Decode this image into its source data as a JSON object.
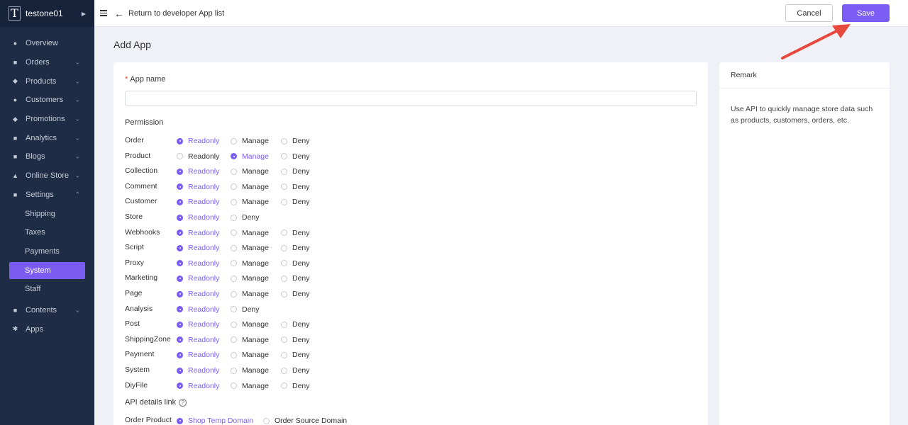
{
  "sidebar": {
    "store_logo": "T",
    "store_name": "testone01",
    "items": [
      {
        "label": "Overview",
        "icon": "overview-icon",
        "chevron": false
      },
      {
        "label": "Orders",
        "icon": "orders-icon",
        "chevron": true
      },
      {
        "label": "Products",
        "icon": "products-icon",
        "chevron": true
      },
      {
        "label": "Customers",
        "icon": "customers-icon",
        "chevron": true
      },
      {
        "label": "Promotions",
        "icon": "promotions-icon",
        "chevron": true
      },
      {
        "label": "Analytics",
        "icon": "analytics-icon",
        "chevron": true
      },
      {
        "label": "Blogs",
        "icon": "blogs-icon",
        "chevron": true
      },
      {
        "label": "Online Store",
        "icon": "online-store-icon",
        "chevron": true
      },
      {
        "label": "Settings",
        "icon": "settings-icon",
        "chevron": true,
        "expanded": true
      }
    ],
    "settings_sub": [
      "Shipping",
      "Taxes",
      "Payments",
      "System",
      "Staff"
    ],
    "active_sub": "System",
    "items_after": [
      {
        "label": "Contents",
        "icon": "contents-icon",
        "chevron": true
      },
      {
        "label": "Apps",
        "icon": "apps-icon",
        "chevron": false
      }
    ]
  },
  "topbar": {
    "back_label": "Return to developer App list",
    "cancel_label": "Cancel",
    "save_label": "Save"
  },
  "page": {
    "title": "Add App"
  },
  "form": {
    "app_name_label": "App name",
    "app_name_value": "",
    "permission_label": "Permission",
    "permissions": [
      {
        "name": "Order",
        "options": [
          "Readonly",
          "Manage",
          "Deny"
        ],
        "selected": "Readonly"
      },
      {
        "name": "Product",
        "options": [
          "Readonly",
          "Manage",
          "Deny"
        ],
        "selected": "Manage"
      },
      {
        "name": "Collection",
        "options": [
          "Readonly",
          "Manage",
          "Deny"
        ],
        "selected": "Readonly"
      },
      {
        "name": "Comment",
        "options": [
          "Readonly",
          "Manage",
          "Deny"
        ],
        "selected": "Readonly"
      },
      {
        "name": "Customer",
        "options": [
          "Readonly",
          "Manage",
          "Deny"
        ],
        "selected": "Readonly"
      },
      {
        "name": "Store",
        "options": [
          "Readonly",
          "Deny"
        ],
        "selected": "Readonly"
      },
      {
        "name": "Webhooks",
        "options": [
          "Readonly",
          "Manage",
          "Deny"
        ],
        "selected": "Readonly"
      },
      {
        "name": "Script",
        "options": [
          "Readonly",
          "Manage",
          "Deny"
        ],
        "selected": "Readonly"
      },
      {
        "name": "Proxy",
        "options": [
          "Readonly",
          "Manage",
          "Deny"
        ],
        "selected": "Readonly"
      },
      {
        "name": "Marketing",
        "options": [
          "Readonly",
          "Manage",
          "Deny"
        ],
        "selected": "Readonly"
      },
      {
        "name": "Page",
        "options": [
          "Readonly",
          "Manage",
          "Deny"
        ],
        "selected": "Readonly"
      },
      {
        "name": "Analysis",
        "options": [
          "Readonly",
          "Deny"
        ],
        "selected": "Readonly"
      },
      {
        "name": "Post",
        "options": [
          "Readonly",
          "Manage",
          "Deny"
        ],
        "selected": "Readonly"
      },
      {
        "name": "ShippingZone",
        "options": [
          "Readonly",
          "Manage",
          "Deny"
        ],
        "selected": "Readonly"
      },
      {
        "name": "Payment",
        "options": [
          "Readonly",
          "Manage",
          "Deny"
        ],
        "selected": "Readonly"
      },
      {
        "name": "System",
        "options": [
          "Readonly",
          "Manage",
          "Deny"
        ],
        "selected": "Readonly"
      },
      {
        "name": "DiyFile",
        "options": [
          "Readonly",
          "Manage",
          "Deny"
        ],
        "selected": "Readonly"
      }
    ],
    "api_details_label": "API details link",
    "api_rows": [
      {
        "name": "Order Product",
        "options": [
          "Shop Temp Domain",
          "Order Source Domain"
        ],
        "selected": "Shop Temp Domain"
      }
    ]
  },
  "remark": {
    "title": "Remark",
    "text": "Use API to quickly manage store data such as products, customers, orders, etc."
  },
  "colors": {
    "accent": "#7b5cf5",
    "sidebar_bg": "#1e2c45",
    "annotation": "#e8493f"
  }
}
